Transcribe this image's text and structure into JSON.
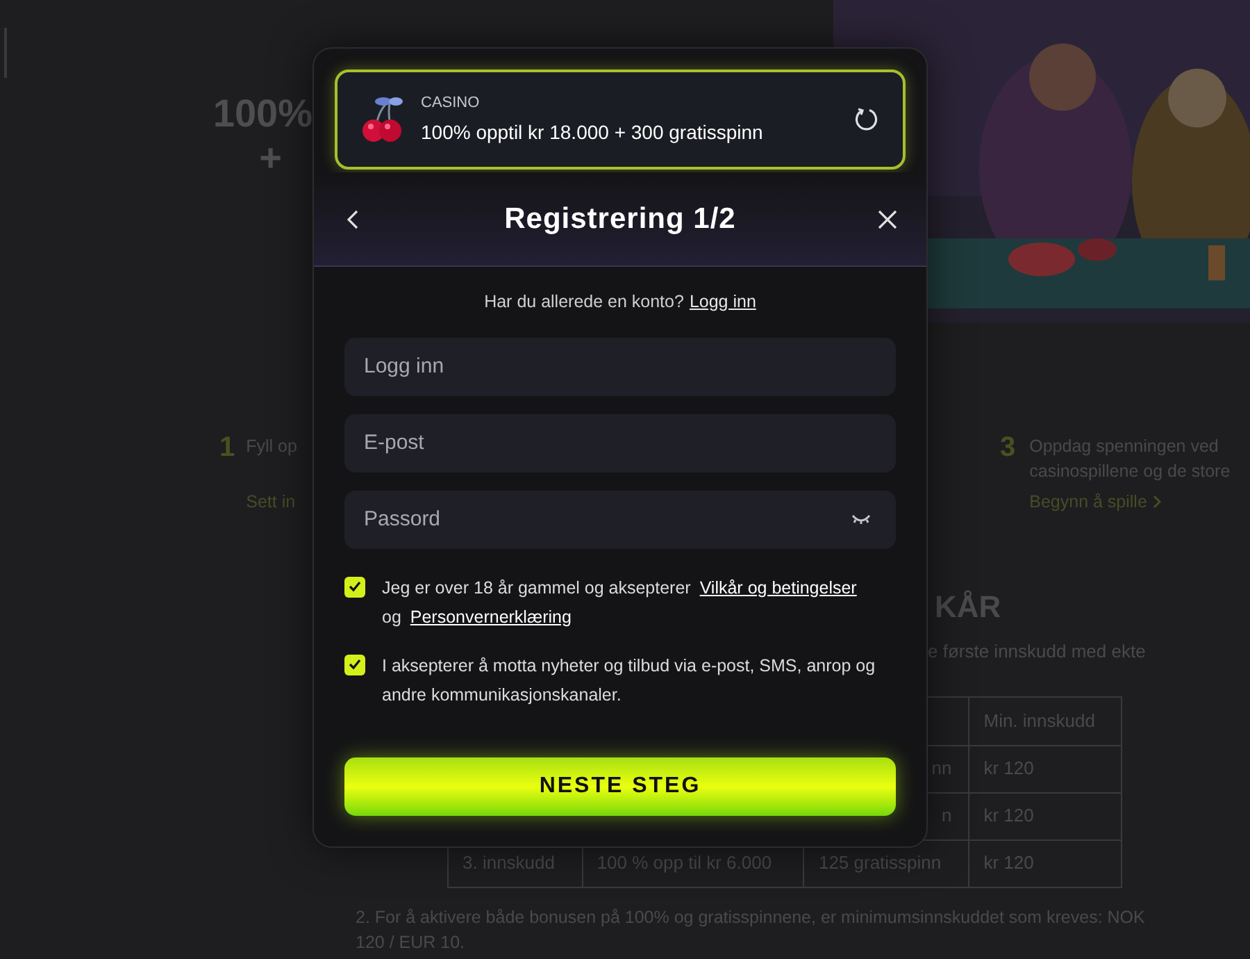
{
  "background": {
    "headline": [
      "100%",
      "+"
    ],
    "steps": [
      {
        "number": "1",
        "lines": [
          "Fyll op"
        ],
        "link": "Sett in"
      },
      {
        "number": "3",
        "lines": [
          "Oppdag spenningen ved",
          "casinospillene og de store"
        ],
        "link": "Begynn å spille"
      }
    ],
    "terms_heading": "KÅR",
    "terms_text": "e første innskudd med ekte",
    "table": {
      "columns": [
        "",
        "",
        "",
        "Min. innskudd"
      ],
      "rows": [
        [
          "",
          "",
          "nn",
          "kr 120"
        ],
        [
          "",
          "",
          "n",
          "kr 120"
        ],
        [
          "3. innskudd",
          "100 % opp til kr 6.000",
          "125 gratisspinn",
          "kr 120"
        ]
      ]
    },
    "footnote": "2. For å aktivere både bonusen på 100% og gratisspinnene, er minimumsinnskuddet som kreves: NOK 120 / EUR 10.",
    "picture": {
      "kind": "picture"
    }
  },
  "modal": {
    "banner": {
      "category": "CASINO",
      "offer": "100% opptil kr 18.000 + 300 gratisspinn"
    },
    "title": "Registrering 1/2",
    "login_prompt": {
      "text": "Har du allerede en konto?",
      "link": "Logg inn"
    },
    "fields": [
      {
        "placeholder": "Logg inn",
        "kind": "text"
      },
      {
        "placeholder": "E-post",
        "kind": "text"
      },
      {
        "placeholder": "Passord",
        "kind": "password"
      }
    ],
    "consents": [
      {
        "checked": true,
        "parts": [
          {
            "kind": "text",
            "text": "Jeg er over 18 år gammel og aksepterer "
          },
          {
            "kind": "link",
            "text": "Vilkår og betingelser"
          },
          {
            "kind": "text",
            "text": " og "
          },
          {
            "kind": "link",
            "text": "Personvernerklæring"
          }
        ]
      },
      {
        "checked": true,
        "parts": [
          {
            "kind": "text",
            "text": "I aksepterer å motta nyheter og tilbud via e-post, SMS, anrop og andre kommunikasjonskanaler."
          }
        ]
      }
    ],
    "submit": "NESTE STEG"
  }
}
